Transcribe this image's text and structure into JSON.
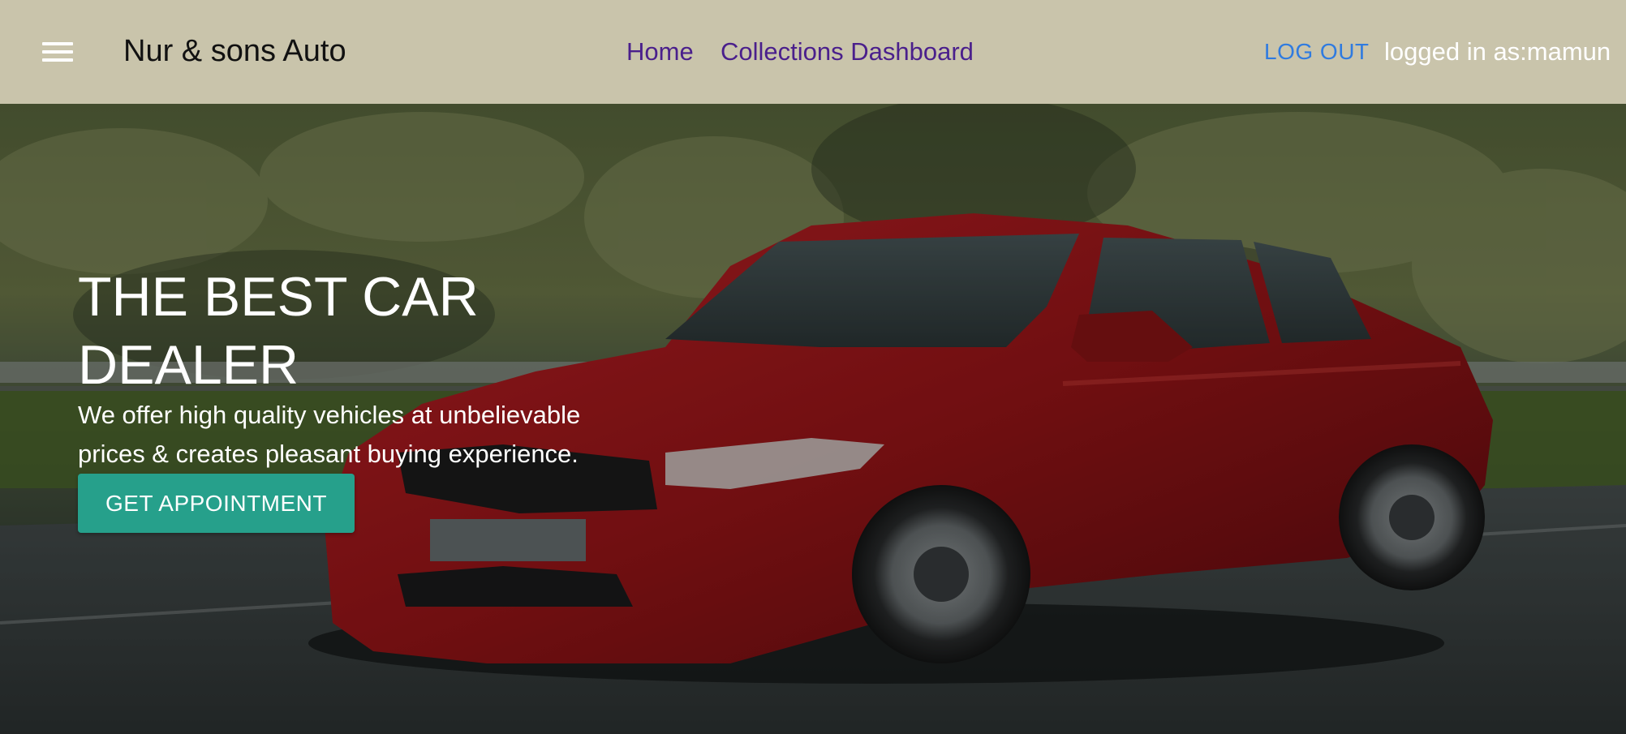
{
  "header": {
    "brand": "Nur & sons Auto",
    "menu_icon": "hamburger-menu-icon",
    "nav": {
      "home": "Home",
      "collections_dashboard": "Collections Dashboard"
    },
    "logout_label": "LOG OUT",
    "logged_in_text": "logged in as:mamun"
  },
  "hero": {
    "title": "THE BEST CAR DEALER",
    "subtitle": "We offer high quality vehicles at unbelievable prices & creates pleasant buying experience.",
    "cta_label": "GET APPOINTMENT"
  },
  "colors": {
    "header_bg": "#c9c4ab",
    "nav_link": "#4a1f8c",
    "logout_link": "#2f7be0",
    "cta_bg": "#26a08b",
    "car_body": "#a11a1c"
  }
}
